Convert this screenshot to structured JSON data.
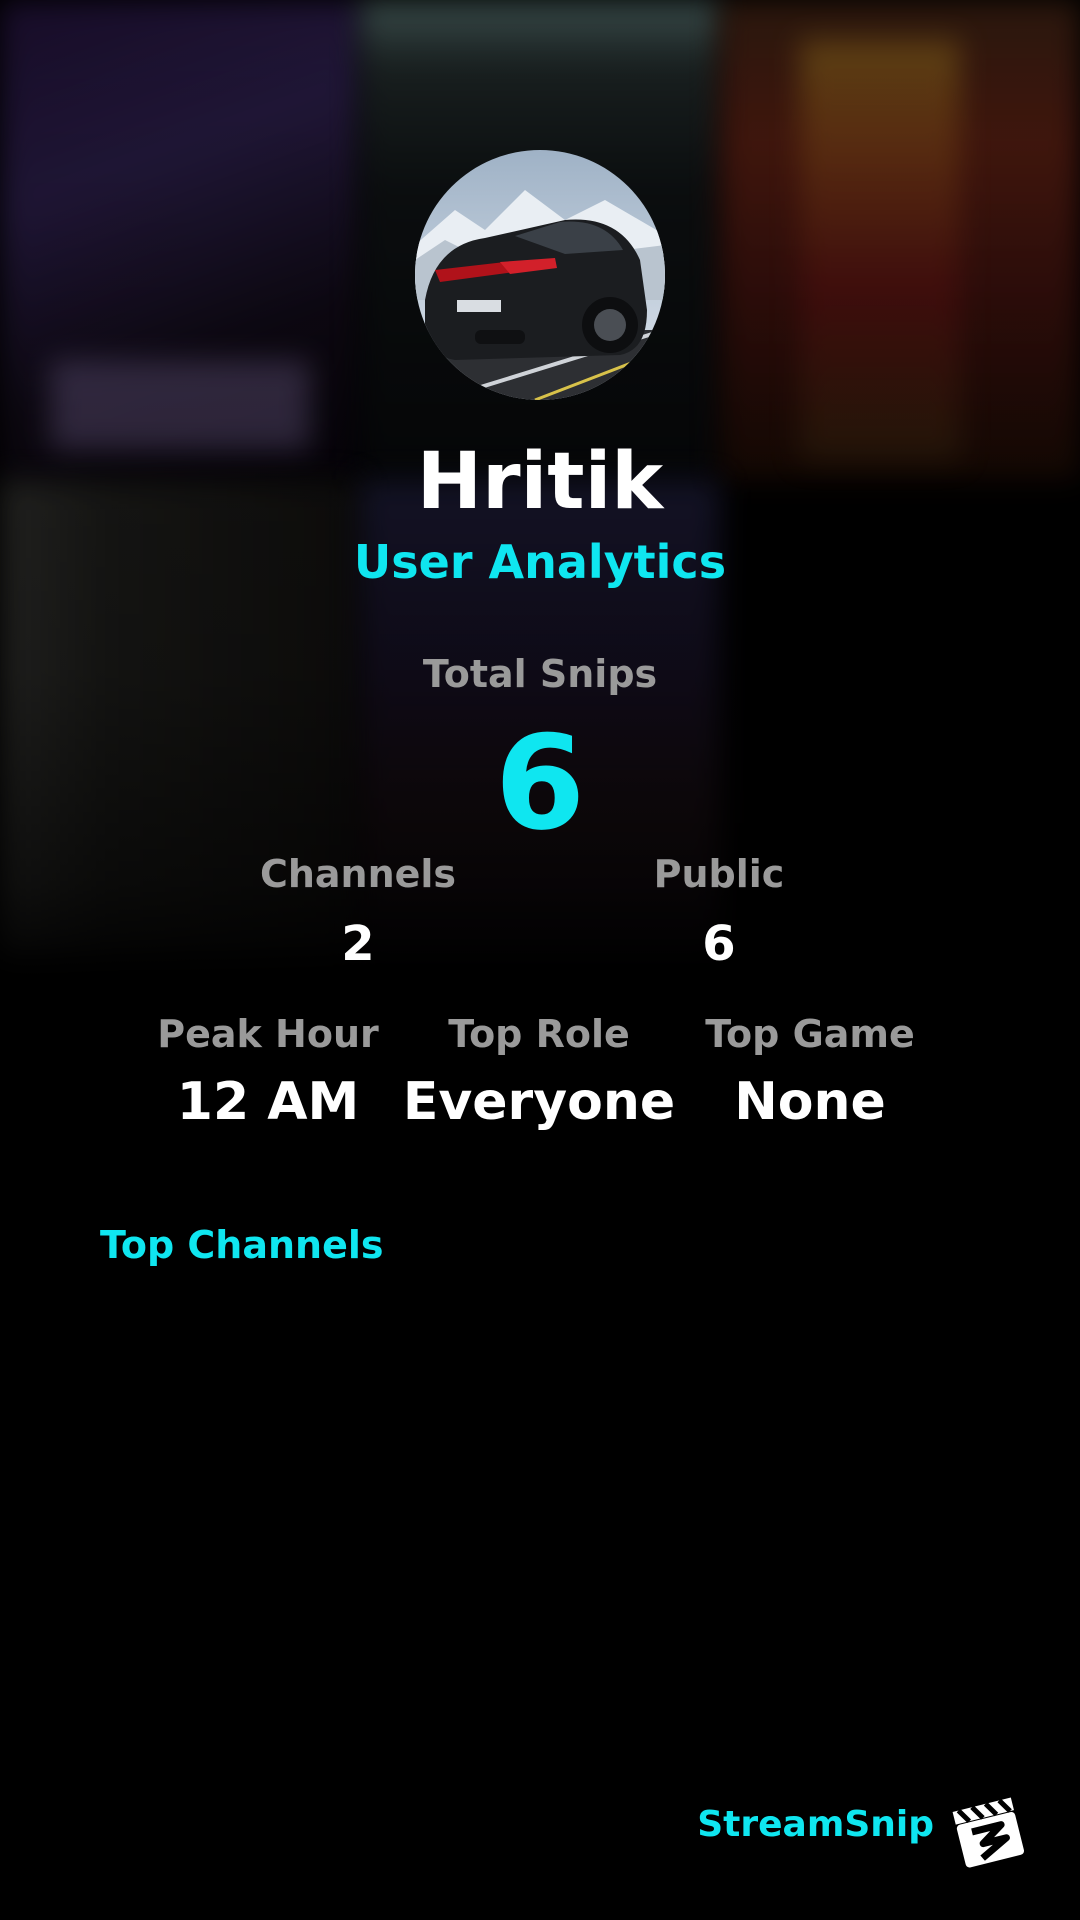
{
  "profile": {
    "username": "Hritik",
    "subtitle": "User Analytics",
    "avatar_icon": "car-avatar-icon"
  },
  "totals": {
    "label": "Total Snips",
    "value": "6"
  },
  "stats_row1": {
    "channels_label": "Channels",
    "channels_value": "2",
    "public_label": "Public",
    "public_value": "6"
  },
  "stats_row2": {
    "peak_hour_label": "Peak Hour",
    "peak_hour_value": "12 AM",
    "top_role_label": "Top Role",
    "top_role_value": "Everyone",
    "top_game_label": "Top Game",
    "top_game_value": "None"
  },
  "sections": {
    "top_channels": "Top Channels"
  },
  "brand": {
    "name": "StreamSnip",
    "logo_icon": "clapperboard-logo-icon"
  },
  "colors": {
    "accent": "#0fe6f0",
    "label": "#9a9a9a",
    "background": "#000000"
  }
}
